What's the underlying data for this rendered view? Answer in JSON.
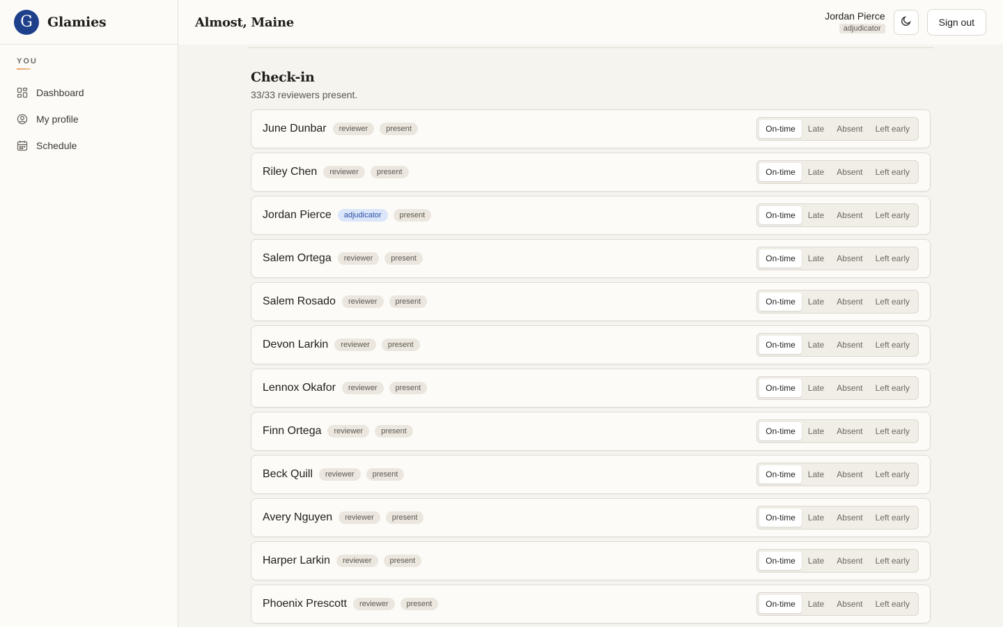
{
  "brand": {
    "name": "Glamies",
    "logo_glyph": "G"
  },
  "sidebar": {
    "heading": "YOU",
    "items": [
      {
        "label": "Dashboard",
        "icon": "grid-icon"
      },
      {
        "label": "My profile",
        "icon": "user-circle-icon"
      },
      {
        "label": "Schedule",
        "icon": "calendar-icon"
      }
    ]
  },
  "header": {
    "title": "Almost, Maine",
    "user_name": "Jordan Pierce",
    "user_role": "adjudicator",
    "theme_toggle_icon": "moon-icon",
    "signout_label": "Sign out"
  },
  "checkin": {
    "title": "Check-in",
    "summary": "33/33 reviewers present.",
    "options": [
      "On-time",
      "Late",
      "Absent",
      "Left early"
    ],
    "rows": [
      {
        "name": "June Dunbar",
        "role": "reviewer",
        "status": "present",
        "selected": "On-time"
      },
      {
        "name": "Riley Chen",
        "role": "reviewer",
        "status": "present",
        "selected": "On-time"
      },
      {
        "name": "Jordan Pierce",
        "role": "adjudicator",
        "status": "present",
        "selected": "On-time"
      },
      {
        "name": "Salem Ortega",
        "role": "reviewer",
        "status": "present",
        "selected": "On-time"
      },
      {
        "name": "Salem Rosado",
        "role": "reviewer",
        "status": "present",
        "selected": "On-time"
      },
      {
        "name": "Devon Larkin",
        "role": "reviewer",
        "status": "present",
        "selected": "On-time"
      },
      {
        "name": "Lennox Okafor",
        "role": "reviewer",
        "status": "present",
        "selected": "On-time"
      },
      {
        "name": "Finn Ortega",
        "role": "reviewer",
        "status": "present",
        "selected": "On-time"
      },
      {
        "name": "Beck Quill",
        "role": "reviewer",
        "status": "present",
        "selected": "On-time"
      },
      {
        "name": "Avery Nguyen",
        "role": "reviewer",
        "status": "present",
        "selected": "On-time"
      },
      {
        "name": "Harper Larkin",
        "role": "reviewer",
        "status": "present",
        "selected": "On-time"
      },
      {
        "name": "Phoenix Prescott",
        "role": "reviewer",
        "status": "present",
        "selected": "On-time"
      }
    ]
  },
  "colors": {
    "brand_blue": "#1e3f8a",
    "adjudicator_pill_bg": "#dbe6fb",
    "adjudicator_pill_text": "#2b4fa0",
    "accent_underline": "#e8a05a"
  }
}
